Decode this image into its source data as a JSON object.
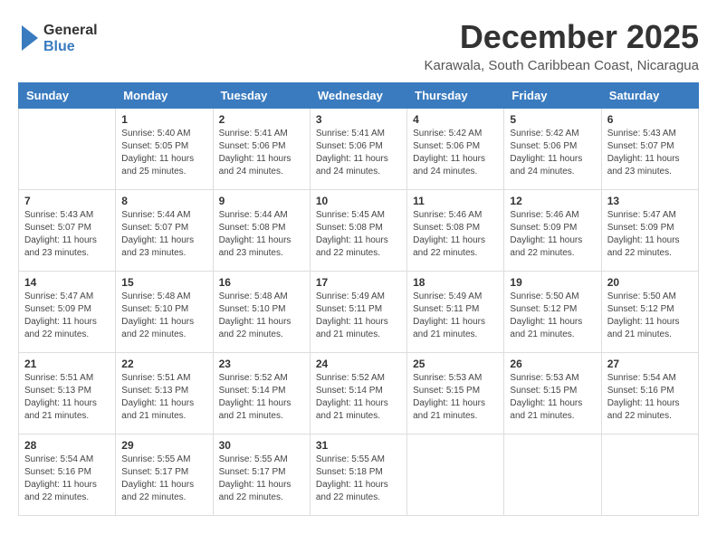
{
  "logo": {
    "line1": "General",
    "line2": "Blue",
    "icon_color": "#3a7bbf"
  },
  "title": "December 2025",
  "subtitle": "Karawala, South Caribbean Coast, Nicaragua",
  "header_color": "#3a7bbf",
  "days_of_week": [
    "Sunday",
    "Monday",
    "Tuesday",
    "Wednesday",
    "Thursday",
    "Friday",
    "Saturday"
  ],
  "weeks": [
    [
      {
        "date": "",
        "sunrise": "",
        "sunset": "",
        "daylight": ""
      },
      {
        "date": "1",
        "sunrise": "Sunrise: 5:40 AM",
        "sunset": "Sunset: 5:05 PM",
        "daylight": "Daylight: 11 hours and 25 minutes."
      },
      {
        "date": "2",
        "sunrise": "Sunrise: 5:41 AM",
        "sunset": "Sunset: 5:06 PM",
        "daylight": "Daylight: 11 hours and 24 minutes."
      },
      {
        "date": "3",
        "sunrise": "Sunrise: 5:41 AM",
        "sunset": "Sunset: 5:06 PM",
        "daylight": "Daylight: 11 hours and 24 minutes."
      },
      {
        "date": "4",
        "sunrise": "Sunrise: 5:42 AM",
        "sunset": "Sunset: 5:06 PM",
        "daylight": "Daylight: 11 hours and 24 minutes."
      },
      {
        "date": "5",
        "sunrise": "Sunrise: 5:42 AM",
        "sunset": "Sunset: 5:06 PM",
        "daylight": "Daylight: 11 hours and 24 minutes."
      },
      {
        "date": "6",
        "sunrise": "Sunrise: 5:43 AM",
        "sunset": "Sunset: 5:07 PM",
        "daylight": "Daylight: 11 hours and 23 minutes."
      }
    ],
    [
      {
        "date": "7",
        "sunrise": "Sunrise: 5:43 AM",
        "sunset": "Sunset: 5:07 PM",
        "daylight": "Daylight: 11 hours and 23 minutes."
      },
      {
        "date": "8",
        "sunrise": "Sunrise: 5:44 AM",
        "sunset": "Sunset: 5:07 PM",
        "daylight": "Daylight: 11 hours and 23 minutes."
      },
      {
        "date": "9",
        "sunrise": "Sunrise: 5:44 AM",
        "sunset": "Sunset: 5:08 PM",
        "daylight": "Daylight: 11 hours and 23 minutes."
      },
      {
        "date": "10",
        "sunrise": "Sunrise: 5:45 AM",
        "sunset": "Sunset: 5:08 PM",
        "daylight": "Daylight: 11 hours and 22 minutes."
      },
      {
        "date": "11",
        "sunrise": "Sunrise: 5:46 AM",
        "sunset": "Sunset: 5:08 PM",
        "daylight": "Daylight: 11 hours and 22 minutes."
      },
      {
        "date": "12",
        "sunrise": "Sunrise: 5:46 AM",
        "sunset": "Sunset: 5:09 PM",
        "daylight": "Daylight: 11 hours and 22 minutes."
      },
      {
        "date": "13",
        "sunrise": "Sunrise: 5:47 AM",
        "sunset": "Sunset: 5:09 PM",
        "daylight": "Daylight: 11 hours and 22 minutes."
      }
    ],
    [
      {
        "date": "14",
        "sunrise": "Sunrise: 5:47 AM",
        "sunset": "Sunset: 5:09 PM",
        "daylight": "Daylight: 11 hours and 22 minutes."
      },
      {
        "date": "15",
        "sunrise": "Sunrise: 5:48 AM",
        "sunset": "Sunset: 5:10 PM",
        "daylight": "Daylight: 11 hours and 22 minutes."
      },
      {
        "date": "16",
        "sunrise": "Sunrise: 5:48 AM",
        "sunset": "Sunset: 5:10 PM",
        "daylight": "Daylight: 11 hours and 22 minutes."
      },
      {
        "date": "17",
        "sunrise": "Sunrise: 5:49 AM",
        "sunset": "Sunset: 5:11 PM",
        "daylight": "Daylight: 11 hours and 21 minutes."
      },
      {
        "date": "18",
        "sunrise": "Sunrise: 5:49 AM",
        "sunset": "Sunset: 5:11 PM",
        "daylight": "Daylight: 11 hours and 21 minutes."
      },
      {
        "date": "19",
        "sunrise": "Sunrise: 5:50 AM",
        "sunset": "Sunset: 5:12 PM",
        "daylight": "Daylight: 11 hours and 21 minutes."
      },
      {
        "date": "20",
        "sunrise": "Sunrise: 5:50 AM",
        "sunset": "Sunset: 5:12 PM",
        "daylight": "Daylight: 11 hours and 21 minutes."
      }
    ],
    [
      {
        "date": "21",
        "sunrise": "Sunrise: 5:51 AM",
        "sunset": "Sunset: 5:13 PM",
        "daylight": "Daylight: 11 hours and 21 minutes."
      },
      {
        "date": "22",
        "sunrise": "Sunrise: 5:51 AM",
        "sunset": "Sunset: 5:13 PM",
        "daylight": "Daylight: 11 hours and 21 minutes."
      },
      {
        "date": "23",
        "sunrise": "Sunrise: 5:52 AM",
        "sunset": "Sunset: 5:14 PM",
        "daylight": "Daylight: 11 hours and 21 minutes."
      },
      {
        "date": "24",
        "sunrise": "Sunrise: 5:52 AM",
        "sunset": "Sunset: 5:14 PM",
        "daylight": "Daylight: 11 hours and 21 minutes."
      },
      {
        "date": "25",
        "sunrise": "Sunrise: 5:53 AM",
        "sunset": "Sunset: 5:15 PM",
        "daylight": "Daylight: 11 hours and 21 minutes."
      },
      {
        "date": "26",
        "sunrise": "Sunrise: 5:53 AM",
        "sunset": "Sunset: 5:15 PM",
        "daylight": "Daylight: 11 hours and 21 minutes."
      },
      {
        "date": "27",
        "sunrise": "Sunrise: 5:54 AM",
        "sunset": "Sunset: 5:16 PM",
        "daylight": "Daylight: 11 hours and 22 minutes."
      }
    ],
    [
      {
        "date": "28",
        "sunrise": "Sunrise: 5:54 AM",
        "sunset": "Sunset: 5:16 PM",
        "daylight": "Daylight: 11 hours and 22 minutes."
      },
      {
        "date": "29",
        "sunrise": "Sunrise: 5:55 AM",
        "sunset": "Sunset: 5:17 PM",
        "daylight": "Daylight: 11 hours and 22 minutes."
      },
      {
        "date": "30",
        "sunrise": "Sunrise: 5:55 AM",
        "sunset": "Sunset: 5:17 PM",
        "daylight": "Daylight: 11 hours and 22 minutes."
      },
      {
        "date": "31",
        "sunrise": "Sunrise: 5:55 AM",
        "sunset": "Sunset: 5:18 PM",
        "daylight": "Daylight: 11 hours and 22 minutes."
      },
      {
        "date": "",
        "sunrise": "",
        "sunset": "",
        "daylight": ""
      },
      {
        "date": "",
        "sunrise": "",
        "sunset": "",
        "daylight": ""
      },
      {
        "date": "",
        "sunrise": "",
        "sunset": "",
        "daylight": ""
      }
    ]
  ]
}
